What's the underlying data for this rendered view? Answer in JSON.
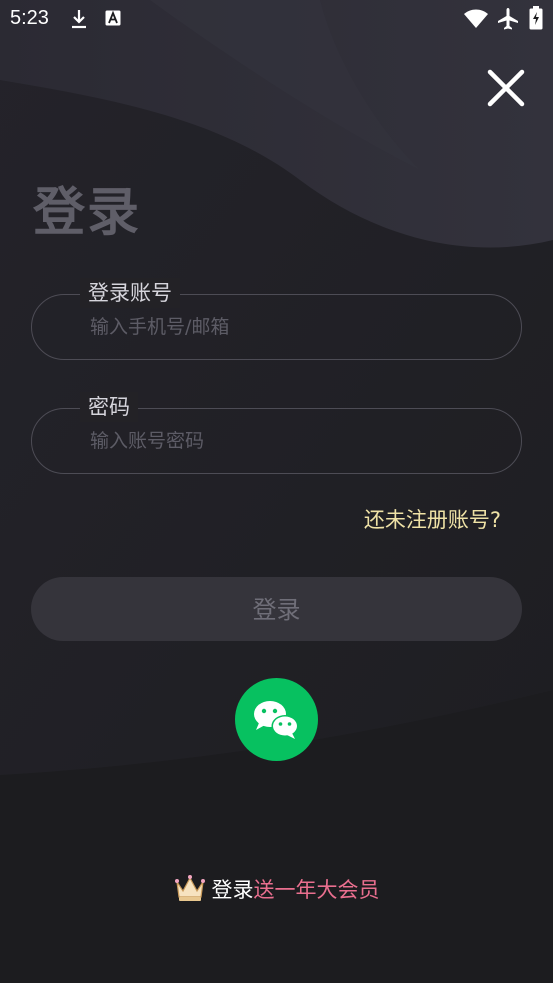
{
  "status_bar": {
    "time": "5:23",
    "left_icons": [
      "download-icon",
      "a-icon"
    ],
    "right_icons": [
      "wifi-icon",
      "airplane-icon",
      "battery-icon"
    ]
  },
  "page": {
    "title": "登录",
    "close_icon": "close-icon"
  },
  "account_field": {
    "label": "登录账号",
    "placeholder": "输入手机号/邮箱",
    "value": ""
  },
  "password_field": {
    "label": "密码",
    "placeholder": "输入账号密码",
    "value": ""
  },
  "register_link": "还未注册账号?",
  "login_button": "登录",
  "wechat_icon": "wechat-icon",
  "promo": {
    "icon": "crown-icon",
    "prefix": "登录",
    "highlight": "送一年大会员"
  },
  "colors": {
    "background": "#1c1c1f",
    "title": "#5f5e68",
    "register_link": "#efe2a6",
    "wechat": "#07c160",
    "promo_highlight": "#ea6f8f"
  }
}
